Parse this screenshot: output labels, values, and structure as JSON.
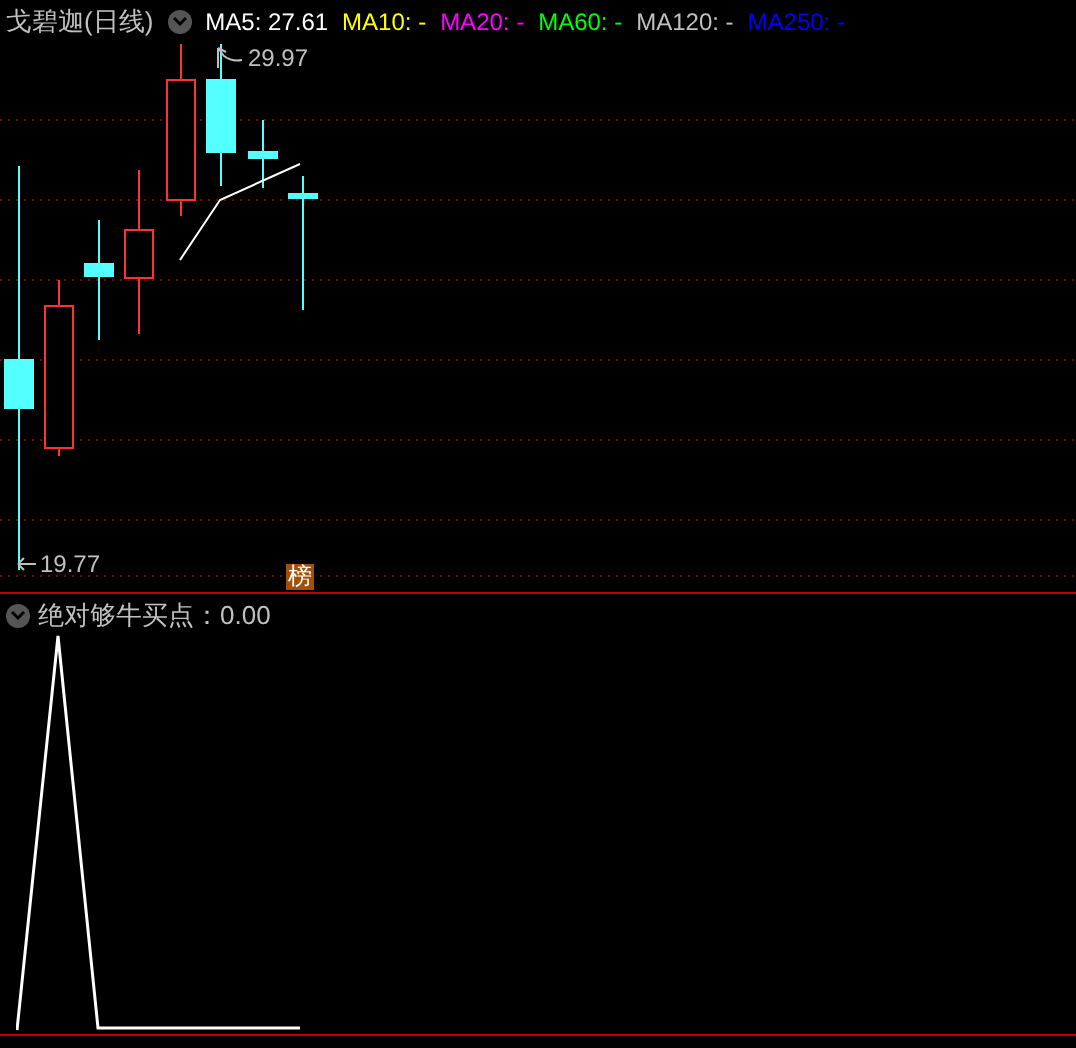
{
  "main_panel": {
    "title": "戈碧迦(日线)",
    "indicators": [
      {
        "label": "MA5: 27.61",
        "color": "#ffffff"
      },
      {
        "label": "MA10: -",
        "color": "#ffff00"
      },
      {
        "label": "MA20: -",
        "color": "#ff00ff"
      },
      {
        "label": "MA60: -",
        "color": "#00ff00"
      },
      {
        "label": "MA120: -",
        "color": "#c0c0c0"
      },
      {
        "label": "MA250: -",
        "color": "#0000ff"
      }
    ],
    "high_label": "29.97",
    "low_label": "19.77",
    "badge": "榜"
  },
  "sub_panel": {
    "title": "绝对够牛买点：0.00"
  }
}
